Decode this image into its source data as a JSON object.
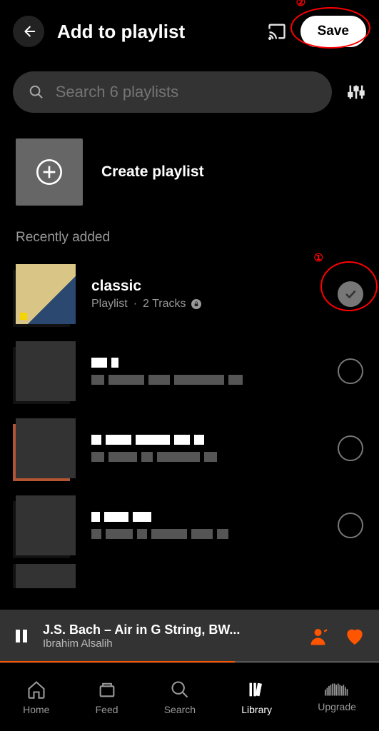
{
  "header": {
    "title": "Add to playlist",
    "save_label": "Save"
  },
  "search": {
    "placeholder": "Search 6 playlists"
  },
  "create": {
    "label": "Create playlist"
  },
  "section_header": "Recently added",
  "playlists": [
    {
      "title": "classic",
      "sub_type": "Playlist",
      "sub_tracks": "2 Tracks",
      "private": true,
      "selected": true
    },
    {
      "title": "",
      "sub_type": "",
      "sub_tracks": "",
      "private": false,
      "selected": false
    },
    {
      "title": "",
      "sub_type": "",
      "sub_tracks": "",
      "private": false,
      "selected": false
    },
    {
      "title": "",
      "sub_type": "",
      "sub_tracks": "",
      "private": false,
      "selected": false
    }
  ],
  "player": {
    "title": "J.S. Bach – Air in G String, BW...",
    "artist": "Ibrahim Alsalih"
  },
  "nav": {
    "home": "Home",
    "feed": "Feed",
    "search": "Search",
    "library": "Library",
    "upgrade": "Upgrade"
  },
  "annotations": {
    "one": "①",
    "two": "②"
  },
  "colors": {
    "accent": "#ff5500"
  }
}
